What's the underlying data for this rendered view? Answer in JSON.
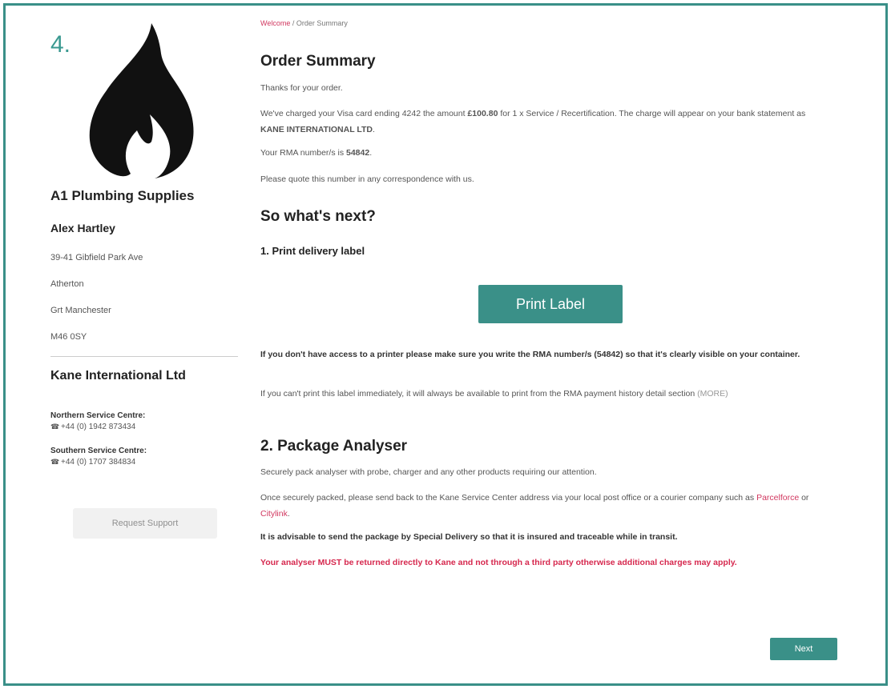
{
  "sidebar": {
    "step_number": "4.",
    "flame_icon": "flame-icon",
    "company_name": "A1 Plumbing Supplies",
    "contact_name": "Alex Hartley",
    "address": [
      "39-41 Gibfield Park Ave",
      "Atherton",
      "Grt Manchester",
      "M46 0SY"
    ],
    "kane_title": "Kane International Ltd",
    "northern_label": "Northern Service Centre:",
    "northern_phone": "+44 (0) 1942 873434",
    "southern_label": "Southern Service Centre:",
    "southern_phone": "+44 (0) 1707 384834",
    "phone_icon": "phone-icon",
    "request_button": "Request Support"
  },
  "breadcrumb": {
    "link": "Welcome",
    "separator": " / ",
    "current": "Order Summary"
  },
  "order": {
    "title": "Order Summary",
    "thanks": "Thanks for your order.",
    "charged_pre": "We've charged your Visa card ending 4242 the amount ",
    "amount": "£100.80",
    "charged_mid": " for 1 x Service / Recertification. The charge will appear on your bank statement as ",
    "statement_name": "KANE INTERNATIONAL LTD",
    "rma_pre": "Your RMA number/s is ",
    "rma_number": "54842",
    "quote": "Please quote this number in any correspondence with us."
  },
  "next_steps": {
    "title": "So what's next?",
    "print_subtitle": "1. Print delivery label",
    "print_button": "Print Label",
    "no_printer": "If you don't have access to a printer please make sure you write the RMA number/s (54842) so that it's clearly visible on your container.",
    "cant_print": "If you can't print this label immediately, it will always be available to print from the RMA payment history detail section ",
    "more_link": "(MORE)",
    "package_title": "2. Package Analyser",
    "secure_pack": "Securely pack analyser with probe, charger and any other products requiring our attention.",
    "once_packed_pre": "Once securely packed, please send back to the Kane Service Center address via your local post office or a courier company such as ",
    "courier_1": "Parcelforce",
    "courier_or": " or ",
    "courier_2": "Citylink",
    "advisable": "It is advisable to send the package by Special Delivery so that it is insured and traceable while in transit.",
    "warning": "Your analyser MUST be returned directly to Kane and not through a third party otherwise additional charges may apply.",
    "next_button": "Next"
  },
  "colors": {
    "teal": "#3a9088",
    "warning_red": "#d6284e",
    "link_pink": "#d1375f"
  }
}
